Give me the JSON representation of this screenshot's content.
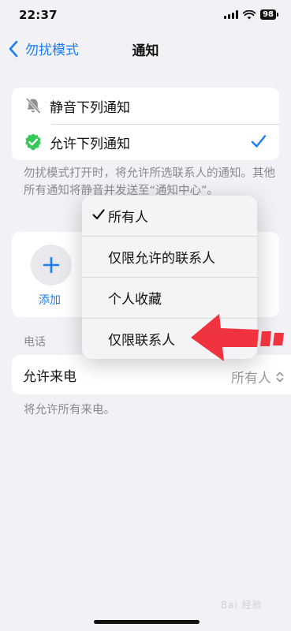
{
  "status": {
    "time": "22:37",
    "battery": "98"
  },
  "nav": {
    "back_label": "勿扰模式",
    "title": "通知"
  },
  "options": [
    {
      "label": "静音下列通知",
      "icon": "bell-slash-icon",
      "selected": false
    },
    {
      "label": "允许下列通知",
      "icon": "verified-badge-icon",
      "selected": true
    }
  ],
  "options_note": "勿扰模式打开时，将允许所选联系人的通知。其他所有通知将静音并发送至“通知中心”。",
  "people": {
    "add_label": "添加"
  },
  "phone": {
    "section_header": "电话",
    "allow_calls_label": "允许来电",
    "allow_calls_value": "所有人",
    "note": "将允许所有来电。"
  },
  "menu": {
    "items": [
      "所有人",
      "仅限允许的联系人",
      "个人收藏",
      "仅限联系人"
    ],
    "selected_index": 0
  },
  "colors": {
    "accent": "#1a7cf5",
    "badge_green": "#34c759",
    "arrow_red": "#f0343f"
  },
  "watermark": "Bai 经验"
}
